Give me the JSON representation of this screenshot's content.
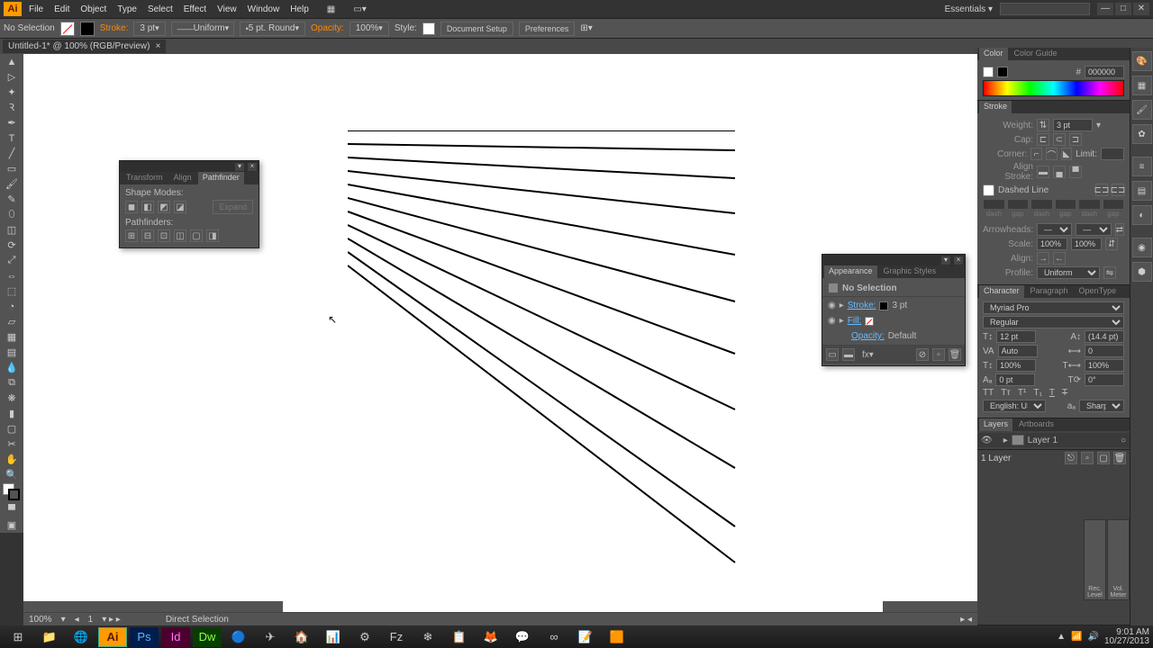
{
  "menu": {
    "items": [
      "File",
      "Edit",
      "Object",
      "Type",
      "Select",
      "Effect",
      "View",
      "Window",
      "Help"
    ]
  },
  "workspace": "Essentials",
  "window": {
    "min": "—",
    "max": "□",
    "close": "✕"
  },
  "control": {
    "selection": "No Selection",
    "stroke_label": "Stroke:",
    "stroke_weight": "3 pt",
    "brush": "Uniform",
    "vprofile": "5 pt. Round",
    "opacity_label": "Opacity:",
    "opacity": "100%",
    "style_label": "Style:",
    "docsetup": "Document Setup",
    "prefs": "Preferences"
  },
  "doc": {
    "tab": "Untitled-1* @ 100% (RGB/Preview)",
    "close": "×"
  },
  "status": {
    "zoom": "100%",
    "page": "1",
    "tool": "Direct Selection"
  },
  "color": {
    "tab1": "Color",
    "tab2": "Color Guide",
    "hex": "000000"
  },
  "stroke": {
    "tab": "Stroke",
    "weight_label": "Weight:",
    "weight": "3 pt",
    "cap_label": "Cap:",
    "corner_label": "Corner:",
    "limit_label": "Limit:",
    "align_label": "Align Stroke:",
    "dashed": "Dashed Line",
    "dash_lbls": [
      "dash",
      "gap",
      "dash",
      "gap",
      "dash",
      "gap"
    ],
    "arrows_label": "Arrowheads:",
    "scale_label": "Scale:",
    "scale1": "100%",
    "scale2": "100%",
    "alignarr_label": "Align:",
    "profile_label": "Profile:",
    "profile": "Uniform"
  },
  "char": {
    "tab1": "Character",
    "tab2": "Paragraph",
    "tab3": "OpenType",
    "font": "Myriad Pro",
    "style": "Regular",
    "size": "12 pt",
    "leading": "(14.4 pt)",
    "kerning": "Auto",
    "tracking": "0",
    "vscale": "100%",
    "hscale": "100%",
    "baseline": "0 pt",
    "rotation": "0°",
    "lang": "English: USA",
    "aa": "Sharp"
  },
  "layers": {
    "tab1": "Layers",
    "tab2": "Artboards",
    "layer": "Layer 1",
    "count": "1 Layer"
  },
  "pathfinder": {
    "tab1": "Transform",
    "tab2": "Align",
    "tab3": "Pathfinder",
    "shape_modes": "Shape Modes:",
    "expand": "Expand",
    "pathfinders": "Pathfinders:"
  },
  "appearance": {
    "tab1": "Appearance",
    "tab2": "Graphic Styles",
    "nosel": "No Selection",
    "stroke": "Stroke:",
    "stroke_val": "3 pt",
    "fill": "Fill:",
    "opacity": "Opacity:",
    "opacity_val": "Default"
  },
  "taskbar": {
    "time": "9:01 AM",
    "date": "10/27/2013",
    "rec": "Rec. Level",
    "vol": "Vol. Meter"
  }
}
